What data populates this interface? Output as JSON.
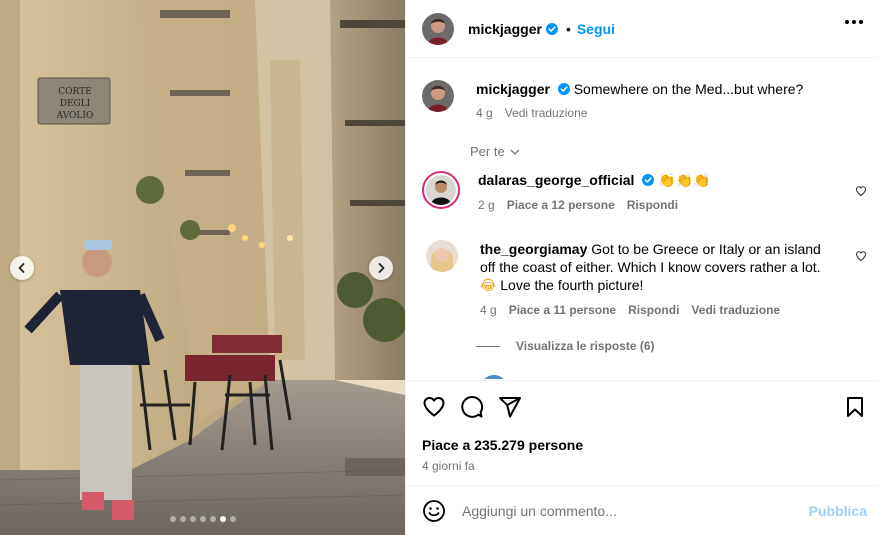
{
  "post": {
    "username": "mickjagger",
    "separator": "•",
    "follow_label": "Segui",
    "caption_user": "mickjagger",
    "caption_text": "Somewhere on the Med...but where?",
    "caption_time": "4 g",
    "caption_translate": "Vedi traduzione",
    "sort_label": "Per te",
    "street_sign_line1": "CORTE",
    "street_sign_line2": "DEGLI AVOLIO",
    "carousel": {
      "count": 7,
      "active_index": 5
    }
  },
  "comments": [
    {
      "user": "dalaras_george_official",
      "verified": true,
      "text": "",
      "emoji": "👏👏👏",
      "time": "2 g",
      "likes": "Piace a 12 persone",
      "reply": "Rispondi"
    },
    {
      "user": "the_georgiamay",
      "verified": false,
      "text": "Got to be Greece or Italy or an island off the coast of either. Which I know covers rather a lot.",
      "emoji_tail": "😂",
      "text2": "Love the fourth picture!",
      "time": "4 g",
      "likes": "Piace a 11 persone",
      "reply": "Rispondi",
      "translate": "Vedi traduzione",
      "view_replies": "Visualizza le risposte (6)"
    }
  ],
  "actions": {
    "likes": "Piace a 235.279 persone",
    "posted": "4 giorni fa"
  },
  "comment_box": {
    "placeholder": "Aggiungi un commento...",
    "publish": "Pubblica"
  },
  "colors": {
    "accent": "#0095f6",
    "publish_disabled": "#9ecff7",
    "muted": "#737373",
    "verified": "#0095f6"
  },
  "icons": [
    "more-icon",
    "verified-icon",
    "heart-icon",
    "comment-icon",
    "share-icon",
    "bookmark-icon",
    "emoji-icon",
    "chevron-left-icon",
    "chevron-right-icon",
    "chevron-down-icon"
  ]
}
